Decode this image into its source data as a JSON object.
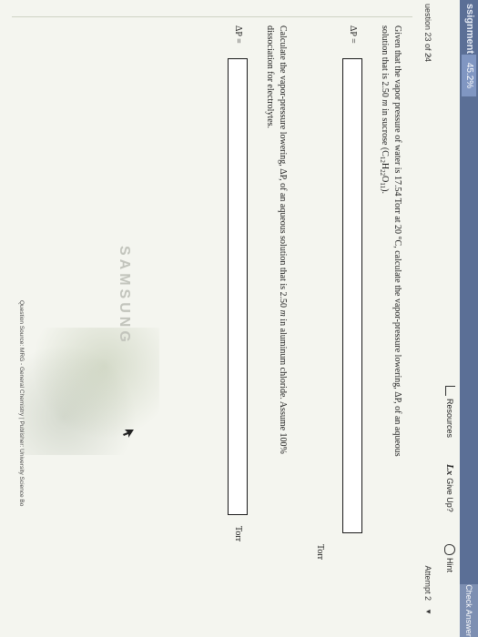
{
  "header": {
    "assignment_label": "ssignment Score:",
    "score_value": "45.2%",
    "check_answer": "Check Answer"
  },
  "toolbar": {
    "resources": "Resources",
    "give_up": "Give Up?",
    "hint": "Hint"
  },
  "question_nav": {
    "label": "uestion 23 of 24",
    "attempt": "Attempt 2"
  },
  "parts": [
    {
      "text_a": "Given that the vapor pressure of water is 17.54 Torr at 20 °C, calculate the vapor-pressure lowering, ΔP, of an aqueous",
      "text_b1": "solution that is 2.50 ",
      "m": "m",
      "text_b2": " in sucrose (C",
      "s1": "12",
      "h": "H",
      "s2": "22",
      "o": "O",
      "s3": "11",
      "close": ").",
      "eq_label": "ΔP =",
      "answer": "",
      "unit": "Torr"
    },
    {
      "text_a1": "Calculate the vapor-pressure lowering, ΔP, of an aqueous solution that is 2.50 ",
      "m": "m",
      "text_a2": " in aluminum chloride. Assume 100%",
      "text_b": "dissociation for electrolytes.",
      "eq_label": "ΔP =",
      "answer": "",
      "unit": "Torr"
    }
  ],
  "source_line": "Question Source: MRG - General Chemistry | Publisher: University Science Bo",
  "device_brand": "SAMSUNG",
  "colors": {
    "header_bg": "#5b6f96",
    "page_bg": "#f4f5ef"
  }
}
